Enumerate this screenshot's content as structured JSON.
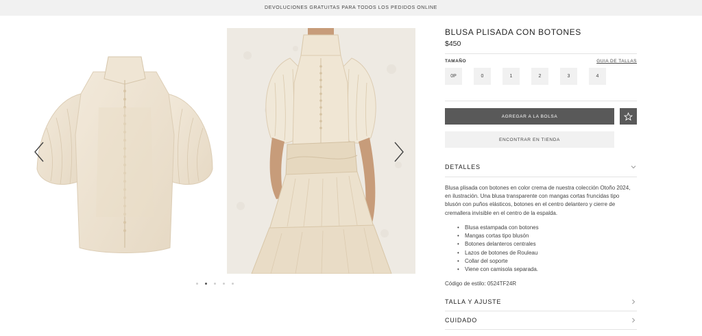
{
  "promo": {
    "text": "DEVOLUCIONES GRATUITAS PARA TODOS LOS PEDIDOS ONLINE"
  },
  "product": {
    "title": "BLUSA PLISADA CON BOTONES",
    "price": "$450",
    "size_label": "TAMAÑO",
    "size_guide": "GUIA DE TALLAS",
    "sizes": [
      "0P",
      "0",
      "1",
      "2",
      "3",
      "4"
    ],
    "add_to_bag": "AGREGAR A LA BOLSA",
    "find_in_store": "ENCONTRAR EN TIENDA",
    "details_label": "DETALLES",
    "description": "Blusa plisada con botones en color crema de nuestra colección Otoño 2024, en ilustración. Una blusa transparente con mangas cortas fruncidas tipo blusón con puños elásticos, botones en el centro delantero y cierre de cremallera invisible en el centro de la espalda.",
    "bullets": [
      "Blusa estampada con botones",
      "Mangas cortas tipo blusón",
      "Botones delanteros centrales",
      "Lazos de botones de Rouleau",
      "Collar del soporte",
      "Viene con camisola separada."
    ],
    "style_code": "Código de estilo: 0524TF24R",
    "fit_label": "TALLA Y AJUSTE",
    "care_label": "CUIDADO"
  },
  "gallery": {
    "dot_count": 5,
    "active_dot": 1
  },
  "colors": {
    "dark_button": "#595959",
    "light_button": "#f1f1f1",
    "garment": "#ede3d2"
  }
}
